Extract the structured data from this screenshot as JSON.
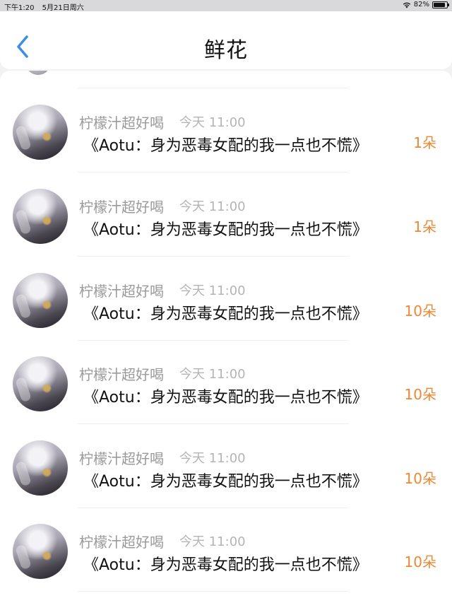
{
  "status_bar": {
    "time": "下午1:20",
    "date": "5月21日周六",
    "battery": "82%"
  },
  "header": {
    "title": "鲜花"
  },
  "colors": {
    "accent": "#3a8ee6",
    "count": "#ee8833",
    "meta_text": "#9a9a9a"
  },
  "gifts": [
    {
      "user": "柠檬汁超好喝",
      "time": "今天 11:00",
      "book": "《Aotu：身为恶毒女配的我一点也不慌》",
      "count": "1朵"
    },
    {
      "user": "柠檬汁超好喝",
      "time": "今天 11:00",
      "book": "《Aotu：身为恶毒女配的我一点也不慌》",
      "count": "1朵"
    },
    {
      "user": "柠檬汁超好喝",
      "time": "今天 11:00",
      "book": "《Aotu：身为恶毒女配的我一点也不慌》",
      "count": "10朵"
    },
    {
      "user": "柠檬汁超好喝",
      "time": "今天 11:00",
      "book": "《Aotu：身为恶毒女配的我一点也不慌》",
      "count": "10朵"
    },
    {
      "user": "柠檬汁超好喝",
      "time": "今天 11:00",
      "book": "《Aotu：身为恶毒女配的我一点也不慌》",
      "count": "10朵"
    },
    {
      "user": "柠檬汁超好喝",
      "time": "今天 11:00",
      "book": "《Aotu：身为恶毒女配的我一点也不慌》",
      "count": "10朵"
    }
  ]
}
